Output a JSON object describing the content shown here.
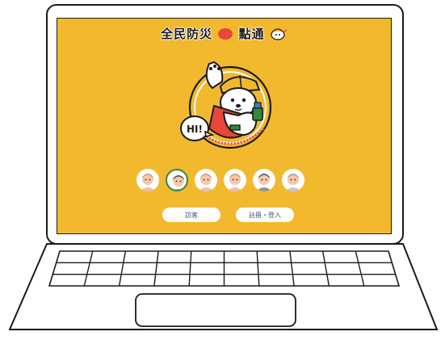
{
  "app": {
    "logo_text_a": "全民防災",
    "logo_text_b": "點通"
  },
  "hero": {
    "speech_bubble": "HI!"
  },
  "avatars": {
    "count": 6,
    "selected_index": 1,
    "skin_color": "#f3c9a8",
    "hair_colors": [
      "#d98c6a",
      "#3a3a3a",
      "#d98c6a",
      "#d98c6a",
      "#3a3a3a",
      "#9a9a9a"
    ]
  },
  "buttons": {
    "guest_label": "訪客",
    "register_label": "註冊・登入"
  },
  "colors": {
    "screen_background": "#f2b92f",
    "accent_red": "#e8473a",
    "selected_ring": "#2f8a3a",
    "button_text": "#3a5a8a"
  }
}
